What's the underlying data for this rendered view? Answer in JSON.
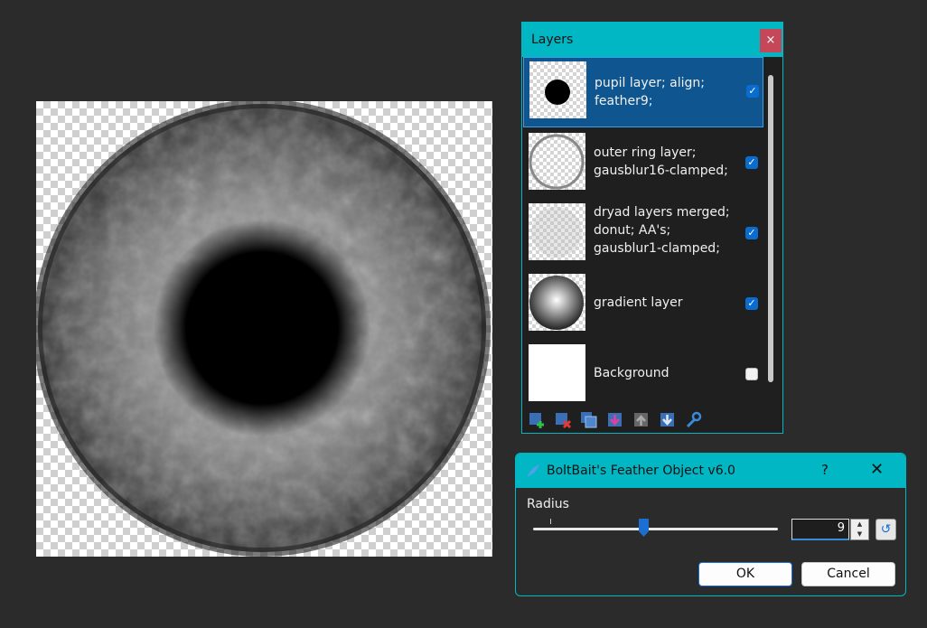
{
  "layers_window": {
    "title": "Layers",
    "close_label": "×",
    "items": [
      {
        "label": "pupil layer; align; feather9;",
        "visible": true,
        "selected": true
      },
      {
        "label": "outer ring layer; gausblur16-clamped;",
        "visible": true,
        "selected": false
      },
      {
        "label": "dryad layers merged; donut; AA's; gausblur1-clamped;",
        "visible": true,
        "selected": false
      },
      {
        "label": "gradient layer",
        "visible": true,
        "selected": false
      },
      {
        "label": "Background",
        "visible": false,
        "selected": false
      }
    ],
    "toolbar": [
      "add-layer-icon",
      "delete-layer-icon",
      "duplicate-layer-icon",
      "merge-down-icon",
      "move-up-icon",
      "move-down-icon",
      "properties-wrench-icon"
    ]
  },
  "dialog": {
    "title": "BoltBait's Feather Object v6.0",
    "help_label": "?",
    "close_label": "✕",
    "radius_label": "Radius",
    "radius_value": "9",
    "ok_label": "OK",
    "cancel_label": "Cancel"
  },
  "colors": {
    "accent": "#00b7c3",
    "selection": "#0f5590",
    "checkbox": "#0b6cd0",
    "close_red": "#c4475a"
  }
}
